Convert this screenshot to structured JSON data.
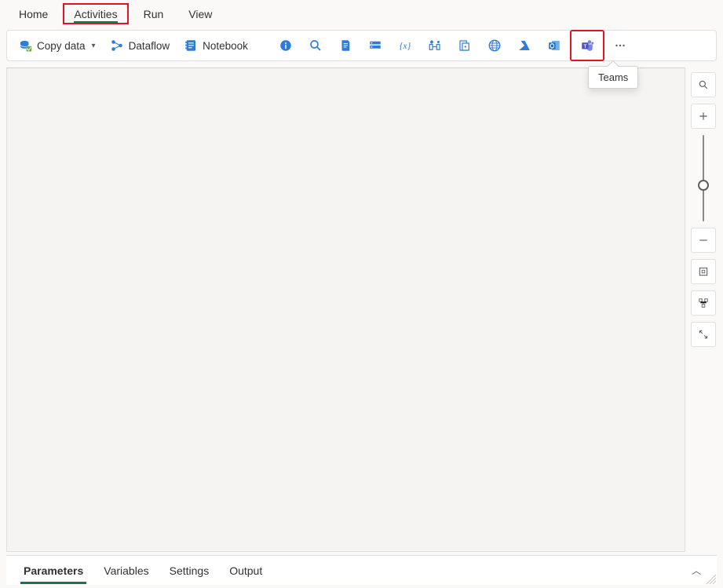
{
  "topTabs": {
    "home": "Home",
    "activities": "Activities",
    "run": "Run",
    "view": "View"
  },
  "toolbar": {
    "copyData": "Copy data",
    "dataflow": "Dataflow",
    "notebook": "Notebook"
  },
  "tooltip": {
    "teams": "Teams"
  },
  "bottomTabs": {
    "parameters": "Parameters",
    "variables": "Variables",
    "settings": "Settings",
    "output": "Output"
  }
}
